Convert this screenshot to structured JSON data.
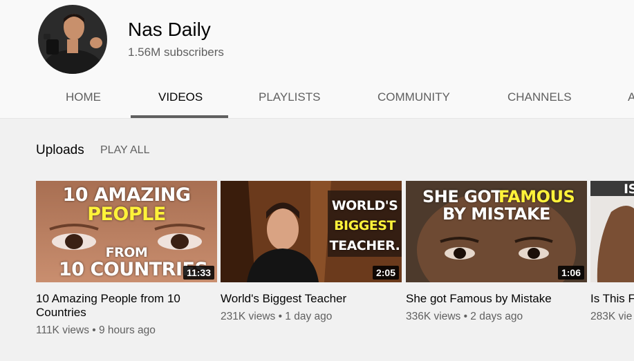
{
  "channel": {
    "name": "Nas Daily",
    "subscribers": "1.56M subscribers"
  },
  "tabs": [
    {
      "label": "HOME"
    },
    {
      "label": "VIDEOS"
    },
    {
      "label": "PLAYLISTS"
    },
    {
      "label": "COMMUNITY"
    },
    {
      "label": "CHANNELS"
    },
    {
      "label": "A"
    }
  ],
  "uploads": {
    "title": "Uploads",
    "play_all": "PLAY ALL"
  },
  "videos": [
    {
      "title": "10 Amazing People from 10 Countries",
      "meta": "111K views • 9 hours ago",
      "duration": "11:33",
      "thumb_text": [
        "10 AMAZING",
        "PEOPLE",
        "FROM",
        "10 COUNTRIES"
      ]
    },
    {
      "title": "World's Biggest Teacher",
      "meta": "231K views • 1 day ago",
      "duration": "2:05",
      "thumb_text": [
        "WORLD'S",
        "BIGGEST",
        "TEACHER."
      ]
    },
    {
      "title": "She got Famous by Mistake",
      "meta": "336K views • 2 days ago",
      "duration": "1:06",
      "thumb_text": [
        "SHE GOT",
        "FAMOUS",
        "BY MISTAKE"
      ]
    },
    {
      "title": "Is This F",
      "meta": "283K vie",
      "thumb_text": [
        "IS"
      ]
    }
  ],
  "colors": {
    "header_bg": "#f9f9f9",
    "content_bg": "#f1f1f1",
    "text_primary": "#030303",
    "text_secondary": "#606060",
    "thumb_highlight": "#fff23a"
  }
}
